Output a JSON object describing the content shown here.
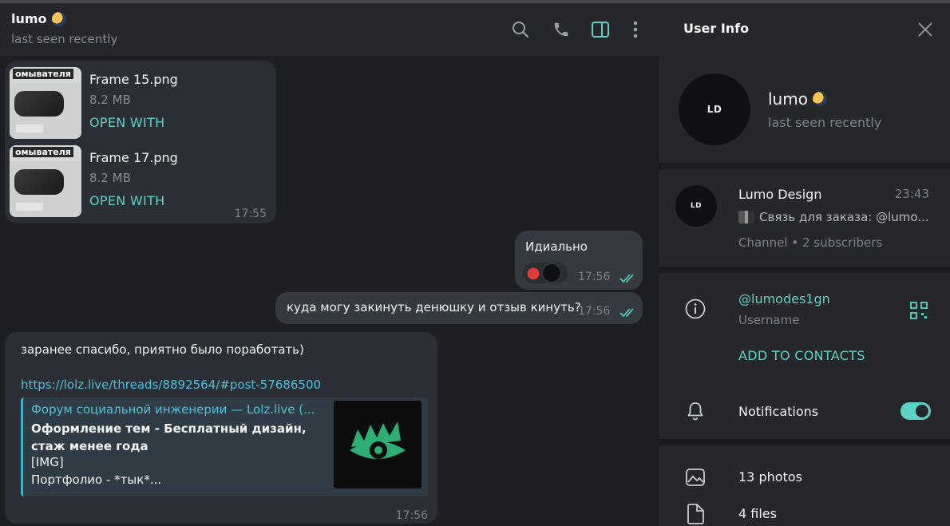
{
  "chat": {
    "peer_name": "lumo",
    "peer_status": "last seen recently",
    "header_icons": [
      "search-icon",
      "phone-icon",
      "sidebar-toggle-icon",
      "more-vertical-icon"
    ],
    "files_message": {
      "files": [
        {
          "name": "Frame 15.png",
          "size": "8.2 MB",
          "action": "OPEN WITH",
          "thumb_caption": "омывателя"
        },
        {
          "name": "Frame 17.png",
          "size": "8.2 MB",
          "action": "OPEN WITH",
          "thumb_caption": "омывателя"
        }
      ],
      "time": "17:55"
    },
    "out_message_1": {
      "text": "Идиально",
      "time": "17:56"
    },
    "out_message_2": {
      "text": "куда могу закинуть денюшку и отзыв кинуть?",
      "time": "17:56"
    },
    "in_message_link": {
      "text": "заранее спасибо, приятно было поработать)",
      "url": "https://lolz.live/threads/8892564/#post-57686500",
      "preview": {
        "site": "Форум социальной инженерии —  Lolz.live (...",
        "title": "Оформление тем - Бесплатный дизайн, стаж менее года",
        "img": "[IMG]",
        "desc": "Портфолио - *тык*..."
      },
      "time": "17:56"
    },
    "colors": {
      "accent": "#5fd2c6",
      "link": "#4fc2d8",
      "bg": "#1e1f22",
      "bubble_in": "#2b2f35",
      "bubble_out": "#353a41"
    }
  },
  "info": {
    "title": "User Info",
    "name": "lumo",
    "status": "last seen recently",
    "avatar_text": "LD",
    "channel": {
      "name": "Lumo Design",
      "time": "23:43",
      "last_message": "Связь для заказа: @lumo...",
      "subscribers": "Channel • 2 subscribers"
    },
    "username": "@lumodes1gn",
    "username_label": "Username",
    "add_contacts": "ADD TO CONTACTS",
    "notifications": "Notifications",
    "notifications_on": true,
    "photos": "13 photos",
    "files": "4 files"
  }
}
